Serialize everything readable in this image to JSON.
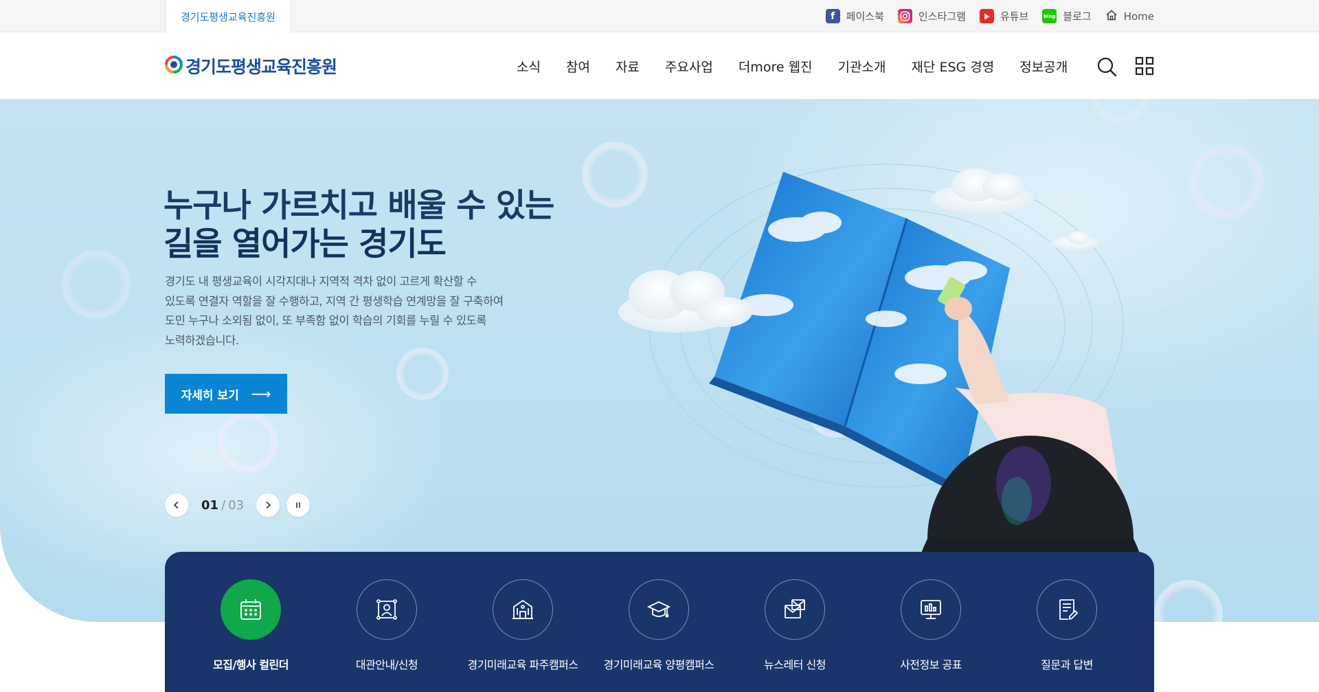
{
  "topbar": {
    "site_tab": "경기도평생교육진흥원",
    "links": [
      {
        "label": "페이스북",
        "icon": "facebook-icon"
      },
      {
        "label": "인스타그램",
        "icon": "instagram-icon"
      },
      {
        "label": "유튜브",
        "icon": "youtube-icon"
      },
      {
        "label": "블로그",
        "icon": "blog-icon",
        "icon_text": "blog"
      },
      {
        "label": "Home",
        "icon": "home-icon"
      }
    ]
  },
  "header": {
    "logo_text": "경기도평생교육진흥원",
    "nav": [
      "소식",
      "참여",
      "자료",
      "주요사업",
      "더more 웹진",
      "기관소개",
      "재단 ESG 경영",
      "정보공개"
    ],
    "search_icon": "search-icon",
    "menu_icon": "grid-menu-icon"
  },
  "hero": {
    "title_line1": "누구나 가르치고 배울 수 있는",
    "title_line2": "길을 열어가는 경기도",
    "desc_lines": [
      "경기도 내 평생교육이 시각지대나 지역적 격차 없이 고르게 확산할 수",
      "있도록 연결자 역할을 잘 수행하고, 지역 간 평생학습 연계망을 잘 구축하여",
      "도민 누구나 소외됨 없이, 또 부족함 없이 학습의 기회를 누릴 수 있도록",
      "노력하겠습니다."
    ],
    "button_label": "자세히 보기",
    "button_arrow": "⟶",
    "slide": {
      "current": "01",
      "separator": "/",
      "total": "03"
    },
    "accent_color": "#0a85d6"
  },
  "quick_menu": {
    "background_color": "#19356a",
    "active_color": "#10a84a",
    "items": [
      {
        "label": "모집/행사 컬린더",
        "icon": "calendar-icon",
        "active": true
      },
      {
        "label": "대관안내/신청",
        "icon": "id-badge-icon",
        "active": false
      },
      {
        "label": "경기미래교육 파주캠퍼스",
        "icon": "building-icon",
        "active": false
      },
      {
        "label": "경기미래교육 양평캠퍼스",
        "icon": "graduation-cap-icon",
        "active": false
      },
      {
        "label": "뉴스레터 신청",
        "icon": "mail-icon",
        "active": false
      },
      {
        "label": "사전정보 공표",
        "icon": "monitor-chart-icon",
        "active": false
      },
      {
        "label": "질문과 답변",
        "icon": "document-edit-icon",
        "active": false
      }
    ]
  }
}
